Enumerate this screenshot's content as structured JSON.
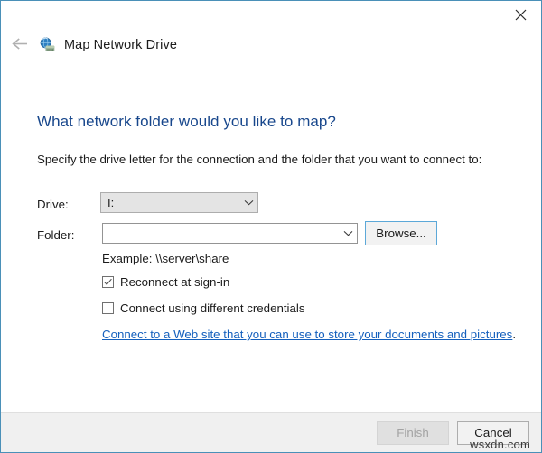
{
  "window": {
    "title": "Map Network Drive",
    "app_icon": "network-drive-icon",
    "back_icon": "back-arrow-icon",
    "close_icon": "close-icon",
    "border_color": "#4a90b8"
  },
  "main": {
    "heading": "What network folder would you like to map?",
    "heading_color": "#18478c",
    "instruction": "Specify the drive letter for the connection and the folder that you want to connect to:",
    "drive": {
      "label": "Drive:",
      "value": "I:",
      "chevron_icon": "chevron-down-icon",
      "disabled_background": "#e4e4e4"
    },
    "folder": {
      "label": "Folder:",
      "value": "",
      "placeholder": "",
      "chevron_icon": "chevron-down-icon",
      "browse_label": "Browse...",
      "browse_focus_color": "#5ca8d8"
    },
    "example": "Example: \\\\server\\share",
    "checkboxes": [
      {
        "label": "Reconnect at sign-in",
        "checked": true,
        "icon": "checkmark-icon"
      },
      {
        "label": "Connect using different credentials",
        "checked": false,
        "icon": "checkmark-icon"
      }
    ],
    "web_link": {
      "text": "Connect to a Web site that you can use to store your documents and pictures",
      "period": ".",
      "color": "#1560bd"
    }
  },
  "footer": {
    "finish_label": "Finish",
    "finish_disabled": true,
    "cancel_label": "Cancel",
    "background": "#f0f0f0"
  },
  "watermark": {
    "text": "wsxdn.com"
  }
}
